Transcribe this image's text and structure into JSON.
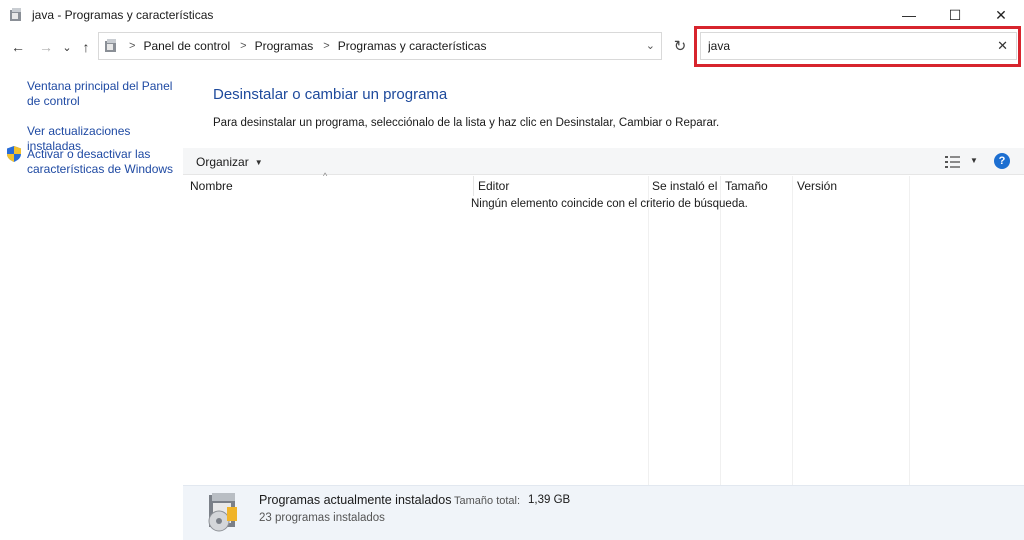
{
  "window": {
    "title": "java - Programas y características",
    "minimize_glyph": "—",
    "maximize_glyph": "☐",
    "close_glyph": "✕"
  },
  "nav": {
    "back_glyph": "←",
    "forward_glyph": "→",
    "recent_glyph": "⌄",
    "up_glyph": "↑",
    "refresh_glyph": "↻",
    "breadcrumb": [
      "Panel de control",
      "Programas",
      "Programas y características"
    ]
  },
  "search": {
    "value": "java",
    "clear_glyph": "✕"
  },
  "sidebar": {
    "items": [
      {
        "label": "Ventana principal del Panel de control"
      },
      {
        "label": "Ver actualizaciones instaladas"
      },
      {
        "label": "Activar o desactivar las características de Windows"
      }
    ]
  },
  "main": {
    "title": "Desinstalar o cambiar un programa",
    "description": "Para desinstalar un programa, selecciónalo de la lista y haz clic en Desinstalar, Cambiar o Reparar."
  },
  "toolbar": {
    "organize_label": "Organizar",
    "help_glyph": "?"
  },
  "table": {
    "columns": [
      "Nombre",
      "Editor",
      "Se instaló el",
      "Tamaño",
      "Versión"
    ],
    "empty_message": "Ningún elemento coincide con el criterio de búsqueda."
  },
  "status": {
    "title": "Programas actualmente instalados",
    "size_label": "Tamaño total:",
    "size_value": "1,39 GB",
    "count": "23 programas instalados"
  },
  "colors": {
    "link": "#1f4aa3",
    "heading": "#1e4a9c",
    "highlight": "#d7242d",
    "help": "#1d6fd1"
  }
}
